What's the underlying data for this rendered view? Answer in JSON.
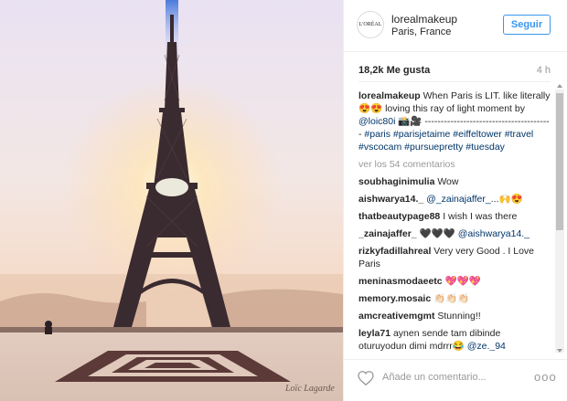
{
  "post": {
    "username": "lorealmakeup",
    "location": "Paris, France",
    "follow_label": "Seguir",
    "avatar_text": "L'ORÉAL",
    "likes": "18,2k Me gusta",
    "time_ago": "4 h",
    "watermark": "Loïc Lagarde"
  },
  "caption": {
    "user": "lorealmakeup",
    "text_1": " When Paris is LIT. like literally 😍😍 loving this ray of light moment by ",
    "mention": "@loic80i",
    "text_2": " 📸🎥 ---------------------------------------- ",
    "hashtags": "#paris #parisjetaime #eiffeltower #travel #vscocam #pursuepretty #tuesday"
  },
  "view_all": "ver los 54 comentarios",
  "comments": [
    {
      "user": "soubhaginimulia",
      "text": " Wow",
      "mention": ""
    },
    {
      "user": "aishwarya14._",
      "text": " ",
      "mention": "@_zainajaffer_",
      "after": "...🙌😍"
    },
    {
      "user": "thatbeautypage88",
      "text": " I wish I was there",
      "mention": ""
    },
    {
      "user": "_zainajaffer_",
      "text": " 🖤🖤🖤 ",
      "mention": "@aishwarya14._"
    },
    {
      "user": "rizkyfadillahreal",
      "text": " Very very Good . I Love Paris",
      "mention": ""
    },
    {
      "user": "meninasmodaeetc",
      "text": " 💖💖💖",
      "mention": ""
    },
    {
      "user": "memory.mosaic",
      "text": " 👏🏻👏🏻👏🏻",
      "mention": ""
    },
    {
      "user": "amcreativemgmt",
      "text": " Stunning!!",
      "mention": ""
    },
    {
      "user": "leyla71",
      "text": " aynen sende tam dibinde oturuyodun dimi mdrrr😂 ",
      "mention": "@ze._94"
    }
  ],
  "footer": {
    "placeholder": "Añade un comentario...",
    "more": "ooo"
  },
  "icons": {
    "heart": "heart-outline-icon",
    "more": "more-options-icon",
    "scroll_up": "scroll-up-arrow-icon",
    "scroll_down": "scroll-down-arrow-icon"
  },
  "colors": {
    "link": "#003569",
    "follow": "#3897f0",
    "muted": "#999999"
  }
}
